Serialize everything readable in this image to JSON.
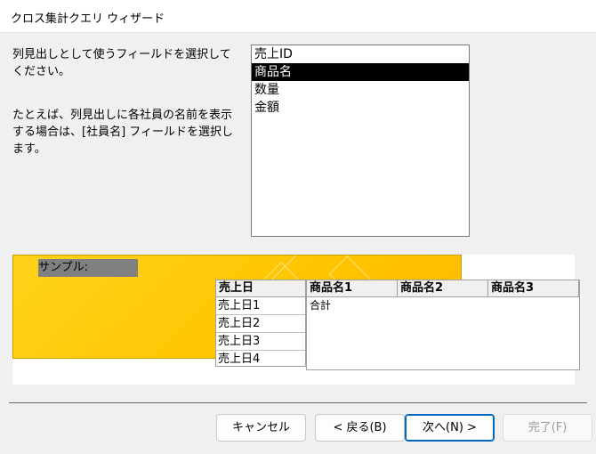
{
  "window": {
    "title": "クロス集計クエリ ウィザード"
  },
  "instructions": {
    "main": "列見出しとして使うフィールドを選択してください。",
    "example": "たとえば、列見出しに各社員の名前を表示する場合は、[社員名] フィールドを選択します。"
  },
  "field_list": {
    "items": [
      {
        "label": "売上ID",
        "selected": false
      },
      {
        "label": "商品名",
        "selected": true
      },
      {
        "label": "数量",
        "selected": false
      },
      {
        "label": "金額",
        "selected": false
      }
    ]
  },
  "sample": {
    "label": "サンプル:",
    "row_header_title": "売上日",
    "row_values": [
      "売上日1",
      "売上日2",
      "売上日3",
      "売上日4"
    ],
    "column_headers": [
      "商品名1",
      "商品名2",
      "商品名3"
    ],
    "total_label": "合計"
  },
  "buttons": {
    "cancel": "キャンセル",
    "back": "< 戻る(B)",
    "next": "次へ(N) >",
    "finish": "完了(F)"
  },
  "colors": {
    "sample_background": "#ffc400",
    "selection": "#000000",
    "primary_border": "#0067c0"
  }
}
